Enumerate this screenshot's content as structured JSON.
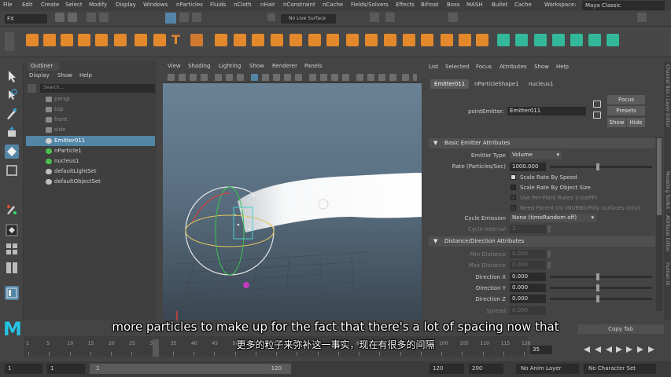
{
  "menubar": {
    "items": [
      "File",
      "Edit",
      "Create",
      "Select",
      "Modify",
      "Display",
      "Windows",
      "nParticles",
      "Fluids",
      "nCloth",
      "nHair",
      "nConstraint",
      "nCache",
      "Fields/Solvers",
      "Effects",
      "Bifrost",
      "Boss",
      "MASH",
      "Bullet",
      "Cache"
    ],
    "workspace_label": "Workspace:",
    "workspace_value": "Maya Classic"
  },
  "statusline": {
    "mode": "FX",
    "live_surface": "No Live Surface"
  },
  "outliner": {
    "tab": "Outliner",
    "menu": [
      "Display",
      "Show",
      "Help"
    ],
    "search_placeholder": "Search...",
    "items": [
      {
        "label": "persp",
        "type": "camera",
        "dim": true
      },
      {
        "label": "top",
        "type": "camera",
        "dim": true
      },
      {
        "label": "front",
        "type": "camera",
        "dim": true
      },
      {
        "label": "side",
        "type": "camera",
        "dim": true
      },
      {
        "label": "Emitter011",
        "type": "emitter",
        "selected": true
      },
      {
        "label": "nParticle1",
        "type": "particle"
      },
      {
        "label": "nucleus1",
        "type": "nucleus"
      },
      {
        "label": "defaultLightSet",
        "type": "set"
      },
      {
        "label": "defaultObjectSet",
        "type": "set"
      }
    ]
  },
  "viewport": {
    "menu": [
      "View",
      "Shading",
      "Lighting",
      "Show",
      "Renderer",
      "Panels"
    ]
  },
  "attribute_editor": {
    "menu": [
      "List",
      "Selected",
      "Focus",
      "Attributes",
      "Show",
      "Help"
    ],
    "tabs": [
      "Emitter011",
      "nParticleShape1",
      "nucleus1"
    ],
    "node_label": "pointEmitter:",
    "node_value": "Emitter011",
    "buttons": {
      "focus": "Focus",
      "presets": "Presets",
      "show": "Show",
      "hide": "Hide"
    },
    "basic_section": "Basic Emitter Attributes",
    "emitter_type_label": "Emitter Type",
    "emitter_type_value": "Volume",
    "rate_label": "Rate (Particles/Sec)",
    "rate_value": "1000.000",
    "checkboxes": [
      {
        "label": "Scale Rate By Speed",
        "checked": true,
        "dim": false
      },
      {
        "label": "Scale Rate By Object Size",
        "checked": false,
        "dim": false
      },
      {
        "label": "Use Per-Point Rates (ratePP)",
        "checked": false,
        "dim": true
      },
      {
        "label": "Need Parent UV (NURBS/Poly surfaces only)",
        "checked": false,
        "dim": true
      }
    ],
    "cycle_emission_label": "Cycle Emission",
    "cycle_emission_value": "None (timeRandom off)",
    "cycle_interval_label": "Cycle Interval",
    "cycle_interval_value": "1",
    "distance_section": "Distance/Direction Attributes",
    "min_distance_label": "Min Distance",
    "min_distance_value": "0.000",
    "max_distance_label": "Max Distance",
    "max_distance_value": "0.000",
    "direction_x_label": "Direction X",
    "direction_x_value": "0.000",
    "direction_y_label": "Direction Y",
    "direction_y_value": "0.000",
    "direction_z_label": "Direction Z",
    "direction_z_value": "0.000",
    "spread_label": "Spread",
    "spread_value": "0.000",
    "copy_tab": "Copy Tab"
  },
  "side_strip": [
    "Channel Box / Layer Editor",
    "Modeling Toolkit",
    "Attribute Editor",
    "Human IK"
  ],
  "timeline": {
    "ticks": [
      "1",
      "5",
      "10",
      "15",
      "20",
      "25",
      "30",
      "35",
      "40",
      "45",
      "50",
      "55",
      "60",
      "65",
      "70",
      "75",
      "80",
      "85",
      "90",
      "95",
      "100",
      "105",
      "110",
      "115",
      "120"
    ],
    "current_frame": "35"
  },
  "range": {
    "start": "1",
    "playback_start": "1",
    "range_start": "1",
    "range_end": "120",
    "playback_end": "120",
    "end": "200",
    "anim_layer": "No Anim Layer",
    "char_set": "No Character Set"
  },
  "subtitles": {
    "en": "more particles to make up for the fact that there's a lot of spacing now that",
    "zh": "更多的粒子来弥补这一事实，现在有很多的间隔"
  },
  "colors": {
    "accent_blue": "#5285a6",
    "maya_logo": "#25c3e4",
    "shelf_orange": "#e4882c",
    "shelf_teal": "#33b89a",
    "particle_white": "#f2f2f2"
  }
}
